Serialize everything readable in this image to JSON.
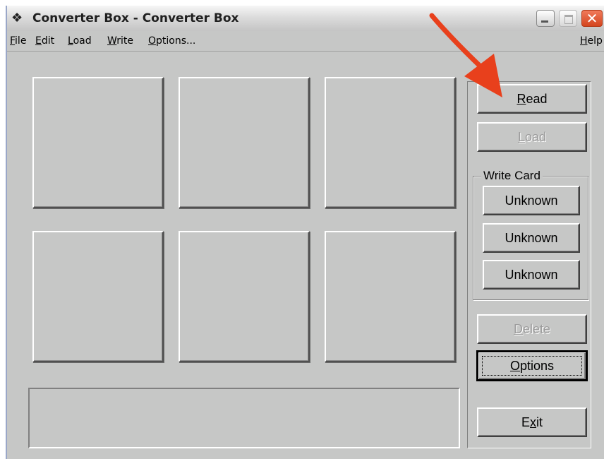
{
  "window": {
    "title": "Converter Box - Converter Box",
    "icon": "app-icon"
  },
  "menu": {
    "items": [
      "File",
      "Edit",
      "Load",
      "Write",
      "Options..."
    ],
    "help": "Help"
  },
  "buttons": {
    "read": "Read",
    "load": "Load",
    "delete": "Delete",
    "options": "Options",
    "exit": "Exit"
  },
  "write_card": {
    "legend": "Write Card",
    "slots": [
      "Unknown",
      "Unknown",
      "Unknown"
    ]
  },
  "annotation": {
    "arrow_color": "#e8401c"
  },
  "colors": {
    "face": "#c6c7c6"
  }
}
